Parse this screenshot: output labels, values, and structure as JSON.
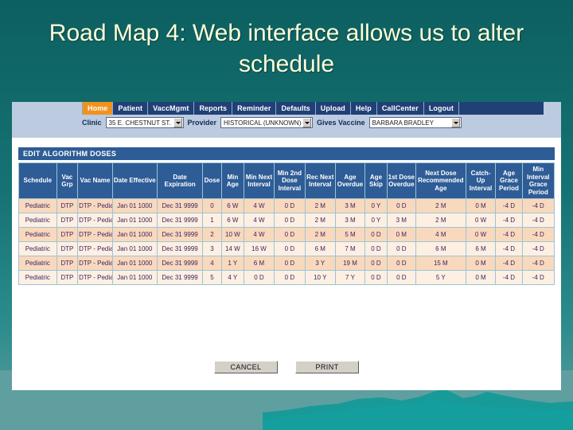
{
  "slide": {
    "title": "Road Map 4: Web interface allows us to alter schedule",
    "accent_orange": "#f2921d",
    "nav_blue": "#204076",
    "header_blue": "#2e5c96",
    "teal_top": "#0d5f60",
    "teal_bottom": "#5f9fa0"
  },
  "app": {
    "nav": [
      {
        "label": "Home",
        "active": true
      },
      {
        "label": "Patient",
        "active": false
      },
      {
        "label": "VaccMgmt",
        "active": false
      },
      {
        "label": "Reports",
        "active": false
      },
      {
        "label": "Reminder",
        "active": false
      },
      {
        "label": "Defaults",
        "active": false
      },
      {
        "label": "Upload",
        "active": false
      },
      {
        "label": "Help",
        "active": false
      },
      {
        "label": "CallCenter",
        "active": false
      },
      {
        "label": "Logout",
        "active": false
      }
    ],
    "selectors": [
      {
        "label": "Clinic",
        "value": "35 E. CHESTNUT ST."
      },
      {
        "label": "Provider",
        "value": "HISTORICAL (UNKNOWN)"
      },
      {
        "label": "Gives Vaccine",
        "value": "BARBARA BRADLEY"
      }
    ],
    "section_title": "EDIT ALGORITHM DOSES",
    "buttons": [
      {
        "label": "CANCEL"
      },
      {
        "label": "PRINT"
      }
    ]
  },
  "table": {
    "columns": [
      "Schedule",
      "Vac Grp",
      "Vac Name",
      "Date Effective",
      "Date Expiration",
      "Dose",
      "Min Age",
      "Min Next Interval",
      "Min 2nd Dose Interval",
      "Rec Next Interval",
      "Age Overdue",
      "Age Skip",
      "1st Dose Overdue",
      "Next Dose Recommended Age",
      "Catch-Up Interval",
      "Age Grace Period",
      "Min Interval Grace Period"
    ],
    "rows": [
      [
        "Pediatric",
        "DTP",
        "DTP - Pediatric",
        "Jan 01 1000",
        "Dec 31 9999",
        "0",
        "6 W",
        "4 W",
        "0 D",
        "2 M",
        "3 M",
        "0 Y",
        "0 D",
        "2 M",
        "0 M",
        "-4 D",
        "-4 D"
      ],
      [
        "Pediatric",
        "DTP",
        "DTP - Pediatric",
        "Jan 01 1000",
        "Dec 31 9999",
        "1",
        "6 W",
        "4 W",
        "0 D",
        "2 M",
        "3 M",
        "0 Y",
        "3 M",
        "2 M",
        "0 W",
        "-4 D",
        "-4 D"
      ],
      [
        "Pediatric",
        "DTP",
        "DTP - Pediatric",
        "Jan 01 1000",
        "Dec 31 9999",
        "2",
        "10 W",
        "4 W",
        "0 D",
        "2 M",
        "5 M",
        "0 D",
        "0 M",
        "4 M",
        "0 W",
        "-4 D",
        "-4 D"
      ],
      [
        "Pediatric",
        "DTP",
        "DTP - Pediatric",
        "Jan 01 1000",
        "Dec 31 9999",
        "3",
        "14 W",
        "16 W",
        "0 D",
        "6 M",
        "7 M",
        "0 D",
        "0 D",
        "6 M",
        "6 M",
        "-4 D",
        "-4 D"
      ],
      [
        "Pediatric",
        "DTP",
        "DTP - Pediatric",
        "Jan 01 1000",
        "Dec 31 9999",
        "4",
        "1 Y",
        "6 M",
        "0 D",
        "3 Y",
        "19 M",
        "0 D",
        "0 D",
        "15 M",
        "0 M",
        "-4 D",
        "-4 D"
      ],
      [
        "Pediatric",
        "DTP",
        "DTP - Pediatric",
        "Jan 01 1000",
        "Dec 31 9999",
        "5",
        "4 Y",
        "0 D",
        "0 D",
        "10 Y",
        "7 Y",
        "0 D",
        "0 D",
        "5 Y",
        "0 M",
        "-4 D",
        "-4 D"
      ]
    ]
  }
}
